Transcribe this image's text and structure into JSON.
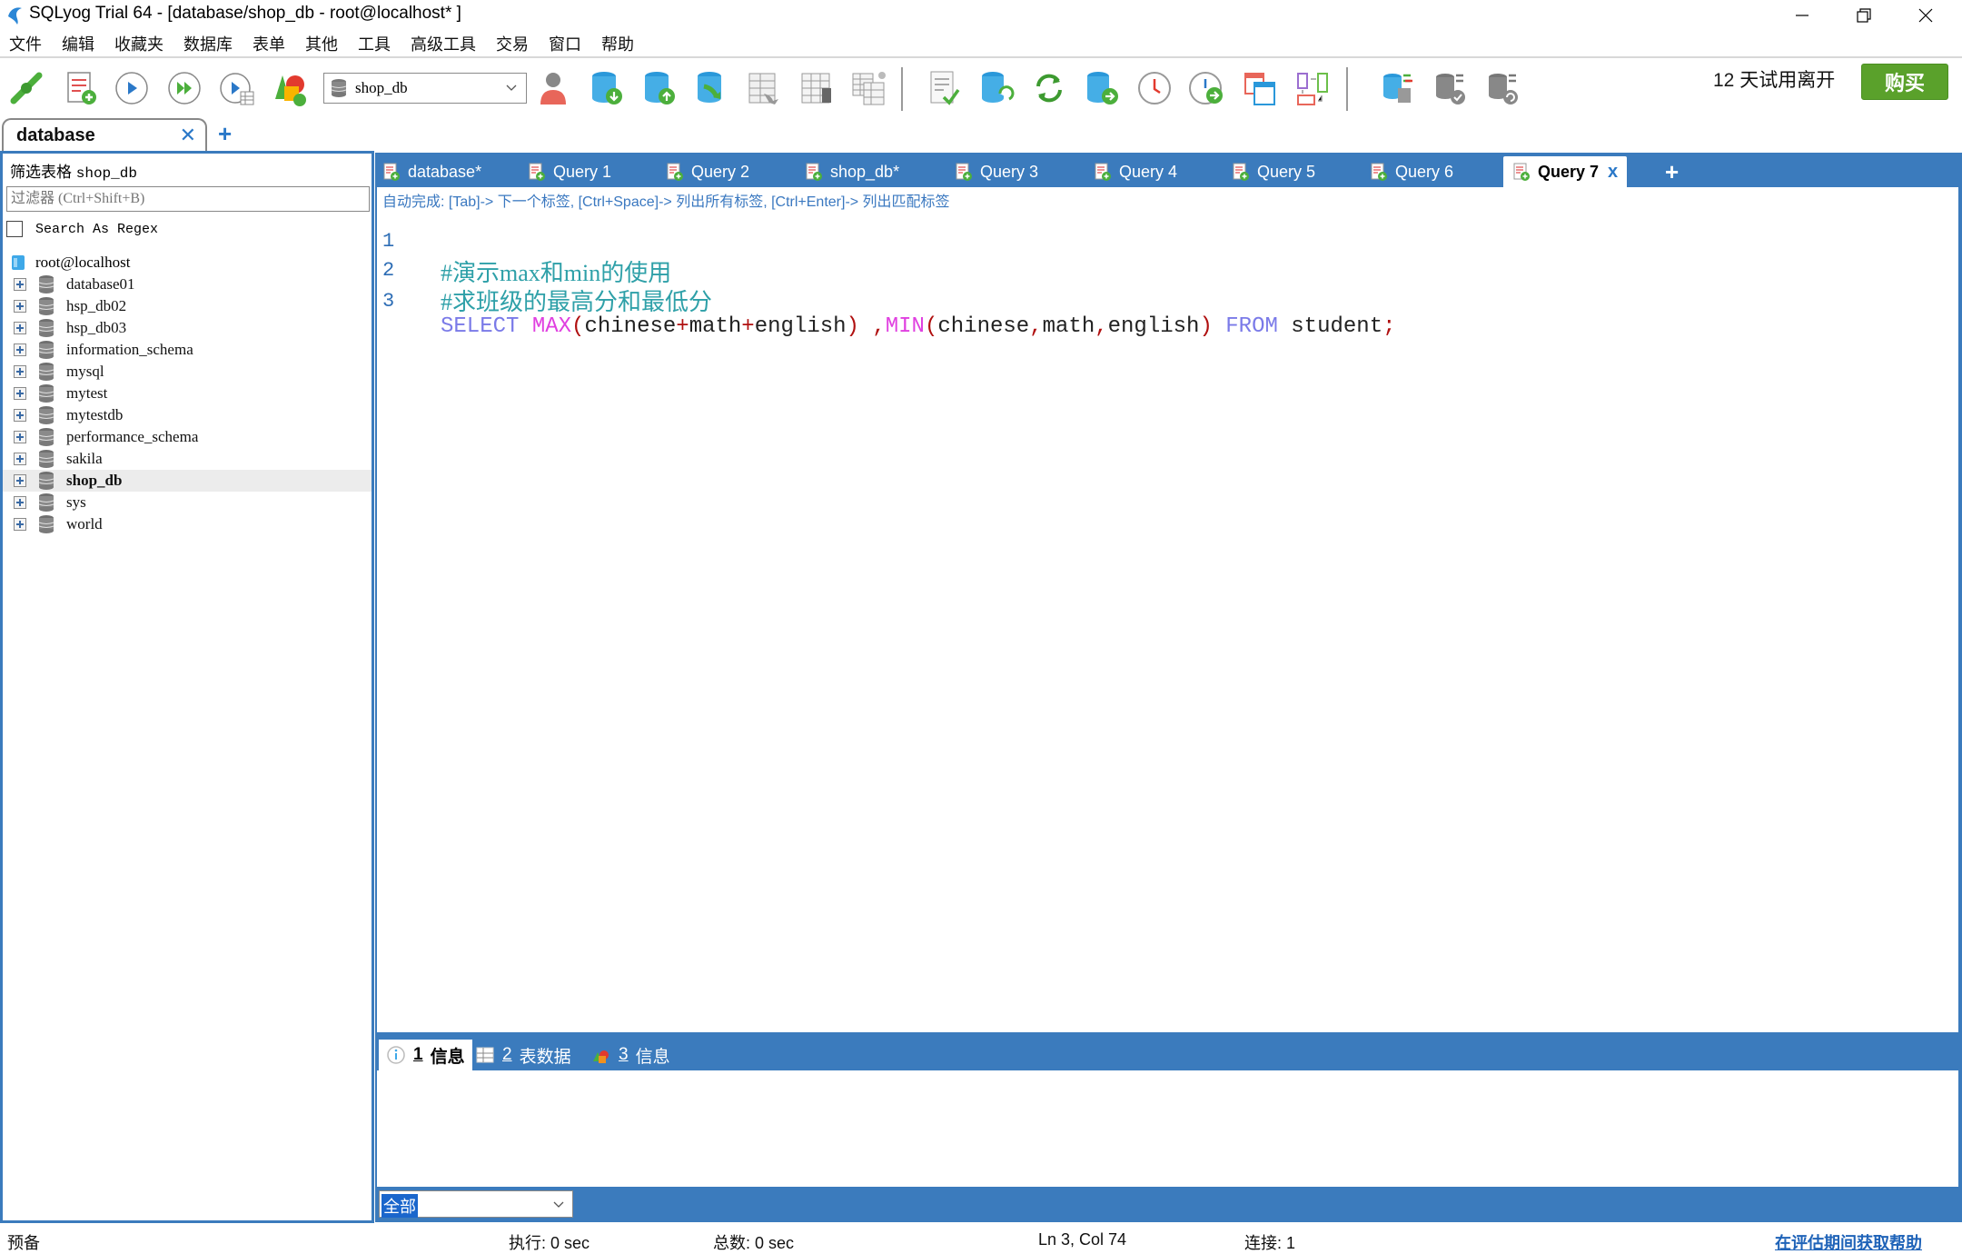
{
  "window": {
    "title": "SQLyog Trial 64 - [database/shop_db - root@localhost* ]",
    "controls": [
      "minimize",
      "restore",
      "close"
    ]
  },
  "menu": {
    "items": [
      "文件",
      "编辑",
      "收藏夹",
      "数据库",
      "表单",
      "其他",
      "工具",
      "高级工具",
      "交易",
      "窗口",
      "帮助"
    ]
  },
  "toolbar": {
    "icons": [
      "new-connection-icon",
      "new-query-icon",
      "execute-query-icon",
      "execute-all-icon",
      "execute-edit-icon",
      "schema-designer-icon",
      "user-manager-icon",
      "backup-database-icon",
      "restore-database-icon",
      "import-external-data-icon",
      "copy-table-icon",
      "alter-table-icon",
      "manage-indexes-icon",
      "sql-check-icon",
      "sync-schema-icon",
      "refresh-icon",
      "data-sync-icon",
      "scheduler-icon",
      "scheduled-backup-icon",
      "schema-compare-icon",
      "query-builder-icon",
      "database-sync-icon",
      "sync-check-icon",
      "sync-restore-icon"
    ],
    "database_selector": {
      "value": "shop_db"
    },
    "trial_text": "12 天试用离开",
    "trial_days": "12",
    "trial_suffix": "天试用离开",
    "buy_label": "购买",
    "buy_color": "#5aa12b"
  },
  "connection_tab": {
    "label": "database",
    "add_label": "+"
  },
  "left_panel": {
    "filter_title_prefix": "筛选表格",
    "filter_db": "shop_db",
    "filter_placeholder": "过滤器 (Ctrl+Shift+B)",
    "regex_label": "Search As Regex",
    "regex_checked": false,
    "root": "root@localhost",
    "databases": [
      {
        "name": "database01"
      },
      {
        "name": "hsp_db02"
      },
      {
        "name": "hsp_db03"
      },
      {
        "name": "information_schema"
      },
      {
        "name": "mysql"
      },
      {
        "name": "mytest"
      },
      {
        "name": "mytestdb"
      },
      {
        "name": "performance_schema"
      },
      {
        "name": "sakila"
      },
      {
        "name": "shop_db",
        "selected": true
      },
      {
        "name": "sys"
      },
      {
        "name": "world"
      }
    ]
  },
  "query_tabs": {
    "tabs": [
      {
        "label": "database*"
      },
      {
        "label": "Query 1"
      },
      {
        "label": "Query 2"
      },
      {
        "label": "shop_db*"
      },
      {
        "label": "Query 3"
      },
      {
        "label": "Query 4"
      },
      {
        "label": "Query 5"
      },
      {
        "label": "Query 6"
      },
      {
        "label": "Query 7",
        "active": true
      }
    ],
    "close_label": "x",
    "add_label": "+"
  },
  "editor": {
    "autocomplete_hint": "自动完成: [Tab]-> 下一个标签, [Ctrl+Space]-> 列出所有标签, [Ctrl+Enter]-> 列出匹配标签",
    "lines": [
      {
        "number": "1",
        "text": "#演示max和min的使用"
      },
      {
        "number": "2",
        "text": "#求班级的最高分和最低分"
      },
      {
        "number": "3",
        "text": "SELECT MAX(chinese+math+english) ,MIN(chinese,math,english) FROM student;"
      }
    ],
    "line3_tokens": {
      "select": "SELECT",
      "max": "MAX",
      "open1": "(",
      "arg1a": "chinese",
      "plus1": "+",
      "arg1b": "math",
      "plus2": "+",
      "arg1c": "english",
      "close1": ")",
      "space_comma": " ,",
      "min": "MIN",
      "open2": "(",
      "arg2a": "chinese",
      "comma1": ",",
      "arg2b": "math",
      "comma2": ",",
      "arg2c": "english",
      "close2": ")",
      "from": "FROM",
      "table": "student",
      "semi": ";"
    },
    "colors": {
      "comment": "#2ea0a8",
      "keyword": "#7a7ae8",
      "function": "#e040e0",
      "punctuation": "#b01010"
    }
  },
  "results": {
    "tabs": [
      {
        "num": "1",
        "label": "信息",
        "active": true
      },
      {
        "num": "2",
        "label": "表数据"
      },
      {
        "num": "3",
        "label": "信息"
      }
    ],
    "filter_value": "全部"
  },
  "status_bar": {
    "state": "预备",
    "exec": "执行: 0 sec",
    "total": "总数: 0 sec",
    "position": "Ln 3, Col 74",
    "connections": "连接: 1",
    "help_link": "在评估期间获取帮助"
  },
  "theme": {
    "accent": "#3b7bbd",
    "link": "#1f63b8"
  }
}
